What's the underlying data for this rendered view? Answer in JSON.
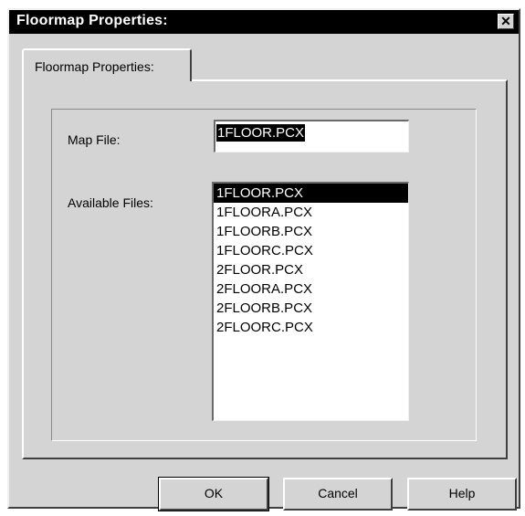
{
  "window": {
    "title": "Floormap Properties:",
    "close_glyph": "✕"
  },
  "tabs": [
    {
      "label": "Floormap Properties:"
    }
  ],
  "form": {
    "map_file_label": "Map File:",
    "map_file_value": "1FLOOR.PCX",
    "available_files_label": "Available Files:"
  },
  "available_files": {
    "selected_index": 0,
    "items": [
      "1FLOOR.PCX",
      "1FLOORA.PCX",
      "1FLOORB.PCX",
      "1FLOORC.PCX",
      "2FLOOR.PCX",
      "2FLOORA.PCX",
      "2FLOORB.PCX",
      "2FLOORC.PCX"
    ]
  },
  "buttons": {
    "ok_label": "OK",
    "cancel_label": "Cancel",
    "help_label": "Help"
  },
  "colors": {
    "face": "#d4d4d4",
    "titlebar": "#000000",
    "selection": "#000000"
  }
}
